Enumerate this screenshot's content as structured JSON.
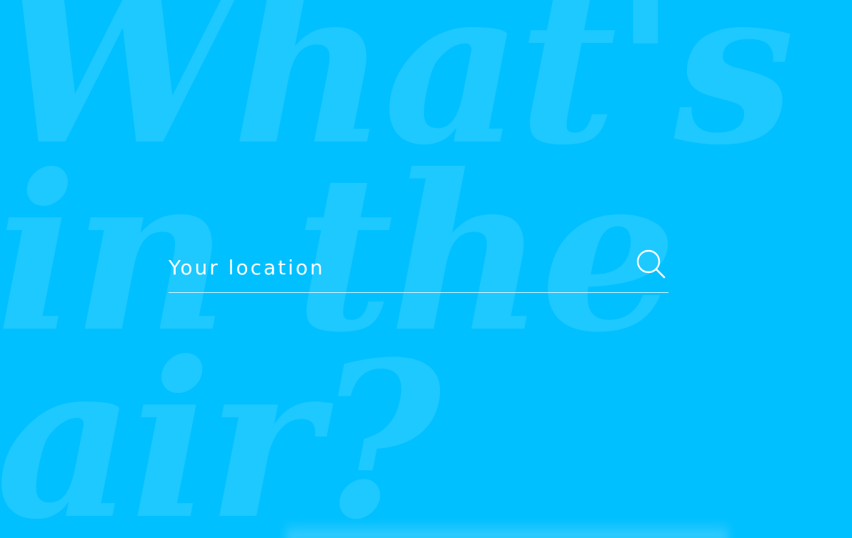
{
  "hero": {
    "headline_lines": [
      "What's",
      "in the",
      "air?"
    ]
  },
  "search": {
    "placeholder": "Your location",
    "value": "",
    "icon": "search-icon"
  },
  "colors": {
    "background": "#00c0ff",
    "headline_text": "#1ec9ff",
    "foreground": "#ffffff"
  }
}
